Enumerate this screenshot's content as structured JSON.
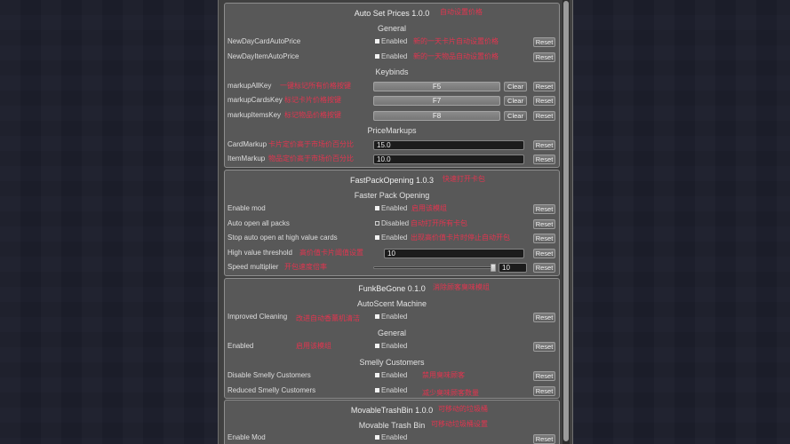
{
  "colors": {
    "background": "#1d1f2c",
    "panel": "#404040",
    "section": "#585858",
    "section_border": "#8e8e8e",
    "annotation": "#e2354f",
    "text": "#dedede"
  },
  "labels": {
    "reset": "Reset",
    "clear": "Clear"
  },
  "mods": [
    {
      "title": "Auto Set Prices 1.0.0",
      "note": "自动设置价格",
      "groups": [
        {
          "heading": "General",
          "rows": [
            {
              "label": "NewDayCardAutoPrice",
              "state": "Enabled",
              "checked": true,
              "note": "新的一天卡片自动设置价格"
            },
            {
              "label": "NewDayItemAutoPrice",
              "state": "Enabled",
              "checked": true,
              "note": "新的一天物品自动设置价格"
            }
          ]
        },
        {
          "heading": "Keybinds",
          "rows": [
            {
              "label": "markupAllKey",
              "key": "F5",
              "note": "一键标记所有价格按键"
            },
            {
              "label": "markupCardsKey",
              "key": "F7",
              "note": "标记卡片价格按键"
            },
            {
              "label": "markupItemsKey",
              "key": "F8",
              "note": "标记物品价格按键"
            }
          ]
        },
        {
          "heading": "PriceMarkups",
          "rows": [
            {
              "label": "CardMarkup",
              "value": "15.0",
              "note": "卡片定价高于市场价百分比"
            },
            {
              "label": "ItemMarkup",
              "value": "10.0",
              "note": "物品定价高于市场价百分比"
            }
          ]
        }
      ]
    },
    {
      "title": "FastPackOpening 1.0.3",
      "note": "快速打开卡包",
      "groups": [
        {
          "heading": "Faster Pack Opening",
          "rows": [
            {
              "label": "Enable mod",
              "state": "Enabled",
              "checked": true,
              "note": "启用该模组"
            },
            {
              "label": "Auto open all packs",
              "state": "Disabled",
              "checked": false,
              "note": "自动打开所有卡包"
            },
            {
              "label": "Stop auto open at high value cards",
              "state": "Enabled",
              "checked": true,
              "note": "出现高价值卡片时停止自动开包"
            },
            {
              "label": "High value threshold",
              "value": "10",
              "note": "高价值卡片阈值设置"
            },
            {
              "label": "Speed multiplier",
              "value": "10",
              "slider_level": 1.0,
              "note": "开包速度倍率"
            }
          ]
        }
      ]
    },
    {
      "title": "FunkBeGone 0.1.0",
      "note": "消除顾客臭味模组",
      "groups": [
        {
          "heading": "AutoScent Machine",
          "rows": [
            {
              "label": "Improved Cleaning",
              "state": "Enabled",
              "checked": true,
              "note": "改进自动香薰机清洁"
            }
          ]
        },
        {
          "heading": "General",
          "rows": [
            {
              "label": "Enabled",
              "state": "Enabled",
              "checked": true,
              "note": "启用该模组"
            }
          ]
        },
        {
          "heading": "Smelly Customers",
          "rows": [
            {
              "label": "Disable Smelly Customers",
              "state": "Enabled",
              "checked": true,
              "note": "禁用臭味顾客"
            },
            {
              "label": "Reduced Smelly Customers",
              "state": "Enabled",
              "checked": true,
              "note": "减少臭味顾客数量"
            }
          ]
        }
      ]
    },
    {
      "title": "MovableTrashBin 1.0.0",
      "note": "可移动的垃圾桶",
      "groups": [
        {
          "heading": "Movable Trash Bin",
          "note": "可移动垃圾桶设置",
          "rows": [
            {
              "label": "Enable Mod",
              "state": "Enabled",
              "checked": true
            }
          ]
        }
      ]
    }
  ]
}
